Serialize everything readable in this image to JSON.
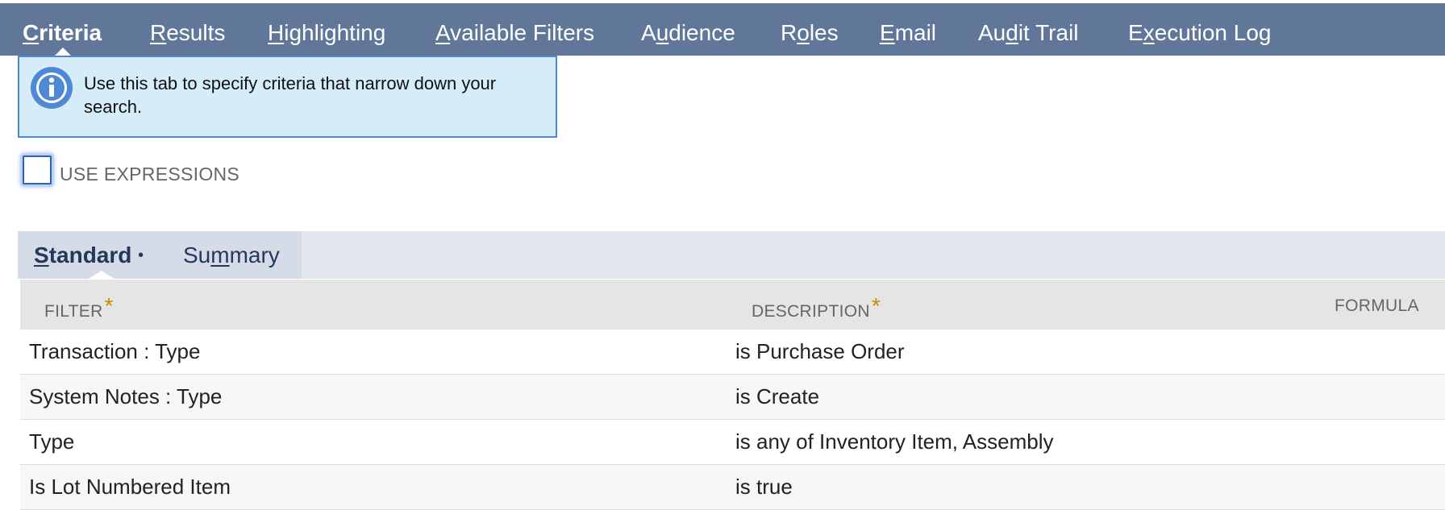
{
  "top_tabs": [
    {
      "pre": "",
      "u": "C",
      "post": "riteria"
    },
    {
      "pre": "",
      "u": "R",
      "post": "esults"
    },
    {
      "pre": "",
      "u": "H",
      "post": "ighlighting"
    },
    {
      "pre": "",
      "u": "A",
      "post": "vailable Filters"
    },
    {
      "pre": "A",
      "u": "u",
      "post": "dience"
    },
    {
      "pre": "R",
      "u": "o",
      "post": "les"
    },
    {
      "pre": "",
      "u": "E",
      "post": "mail"
    },
    {
      "pre": "Au",
      "u": "d",
      "post": "it Trail"
    },
    {
      "pre": "E",
      "u": "x",
      "post": "ecution Log"
    }
  ],
  "info": {
    "message": "Use this tab to specify criteria that narrow down your search."
  },
  "use_expressions": {
    "label": "USE EXPRESSIONS",
    "checked": false
  },
  "subtabs": {
    "standard": {
      "pre": "",
      "u": "S",
      "post": "tandard",
      "marker": "•"
    },
    "summary": {
      "pre": "Su",
      "u": "m",
      "post": "mary"
    }
  },
  "table": {
    "headers": {
      "filter": "FILTER",
      "description": "DESCRIPTION",
      "formula": "FORMULA",
      "required_mark": "*"
    },
    "rows": [
      {
        "filter": "Transaction : Type",
        "description": "is Purchase Order"
      },
      {
        "filter": "System Notes : Type",
        "description": "is Create"
      },
      {
        "filter": "Type",
        "description": "is any of Inventory Item, Assembly"
      },
      {
        "filter": "Is Lot Numbered Item",
        "description": "is true"
      }
    ]
  },
  "colors": {
    "nav_bg": "#607799",
    "info_bg": "#d5edf8",
    "info_border": "#4f89d4",
    "required": "#c88a00",
    "subtab_text": "#24385b"
  }
}
